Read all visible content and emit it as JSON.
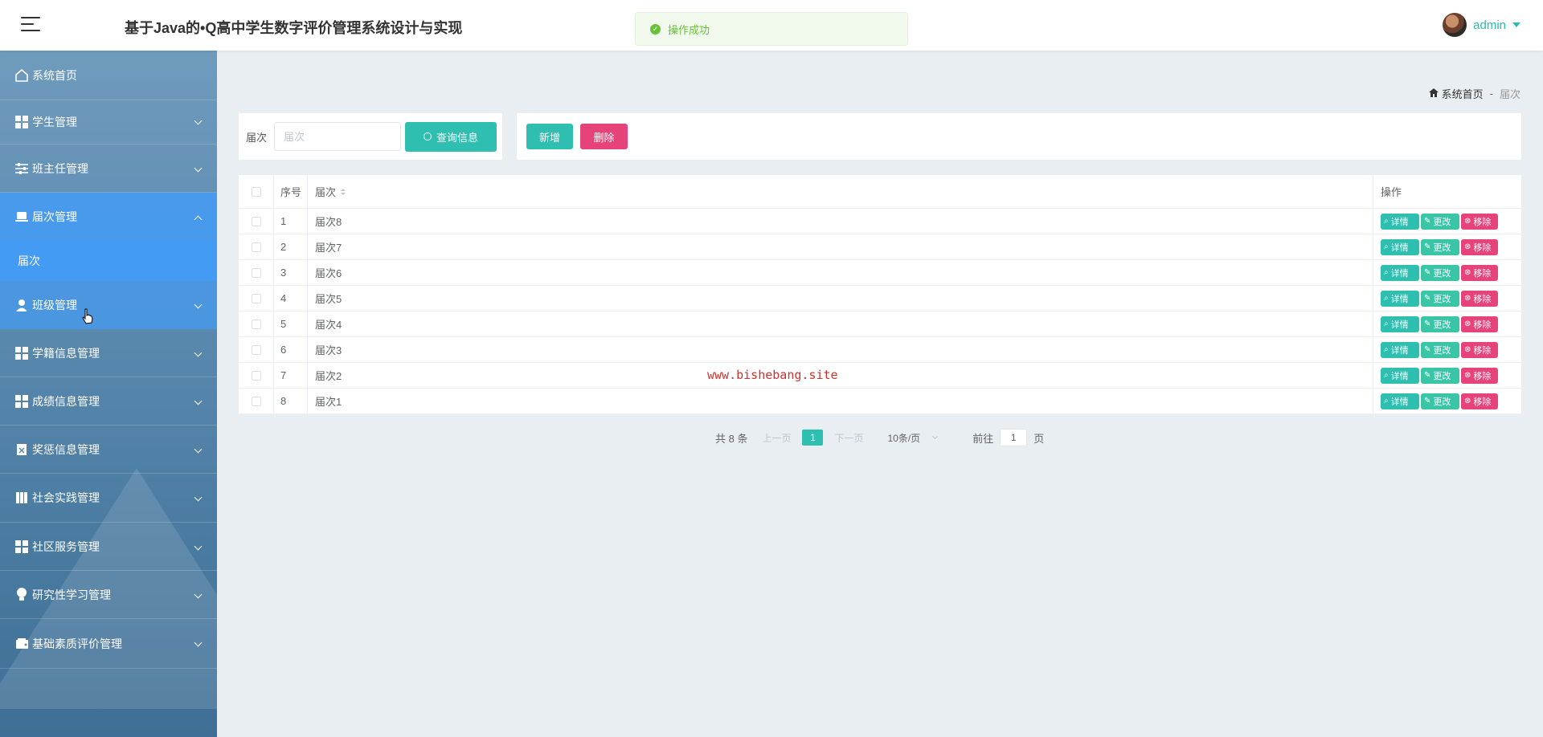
{
  "header": {
    "title": "基于Java的•Q高中学生数字评价管理系统设计与实现",
    "toast": "操作成功",
    "username": "admin"
  },
  "sidebar": {
    "items": [
      {
        "label": "系统首页",
        "icon": "home-icon"
      },
      {
        "label": "学生管理",
        "icon": "grid-icon"
      },
      {
        "label": "班主任管理",
        "icon": "sliders-icon"
      },
      {
        "label": "届次管理",
        "icon": "laptop-icon"
      },
      {
        "label": "班级管理",
        "icon": "user-icon"
      },
      {
        "label": "学籍信息管理",
        "icon": "grid-icon"
      },
      {
        "label": "成绩信息管理",
        "icon": "grid-icon"
      },
      {
        "label": "奖惩信息管理",
        "icon": "clipboard-icon"
      },
      {
        "label": "社会实践管理",
        "icon": "book-icon"
      },
      {
        "label": "社区服务管理",
        "icon": "grid-icon"
      },
      {
        "label": "研究性学习管理",
        "icon": "bulb-icon"
      },
      {
        "label": "基础素质评价管理",
        "icon": "wallet-icon"
      }
    ],
    "submenu": "届次"
  },
  "breadcrumb": {
    "home": "系统首页",
    "sep": "-",
    "current": "届次"
  },
  "search": {
    "label": "届次",
    "placeholder": "届次",
    "button": "查询信息"
  },
  "actions": {
    "add": "新增",
    "delete": "删除"
  },
  "table": {
    "headers": {
      "index": "序号",
      "name": "届次",
      "ops": "操作"
    },
    "rows": [
      {
        "index": "1",
        "name": "届次8"
      },
      {
        "index": "2",
        "name": "届次7"
      },
      {
        "index": "3",
        "name": "届次6"
      },
      {
        "index": "4",
        "name": "届次5"
      },
      {
        "index": "5",
        "name": "届次4"
      },
      {
        "index": "6",
        "name": "届次3"
      },
      {
        "index": "7",
        "name": "届次2"
      },
      {
        "index": "8",
        "name": "届次1"
      }
    ],
    "ops": {
      "detail": "详情",
      "edit": "更改",
      "remove": "移除"
    }
  },
  "watermark": "www.bishebang.site",
  "pagination": {
    "total": "共 8 条",
    "prev": "上一页",
    "page": "1",
    "next": "下一页",
    "size": "10条/页",
    "goto": "前往",
    "goto_value": "1",
    "goto_unit": "页"
  },
  "colors": {
    "accent": "#2ebfb1",
    "danger": "#e6437a",
    "sidebar_active": "#409eff",
    "success": "#67c23a"
  }
}
